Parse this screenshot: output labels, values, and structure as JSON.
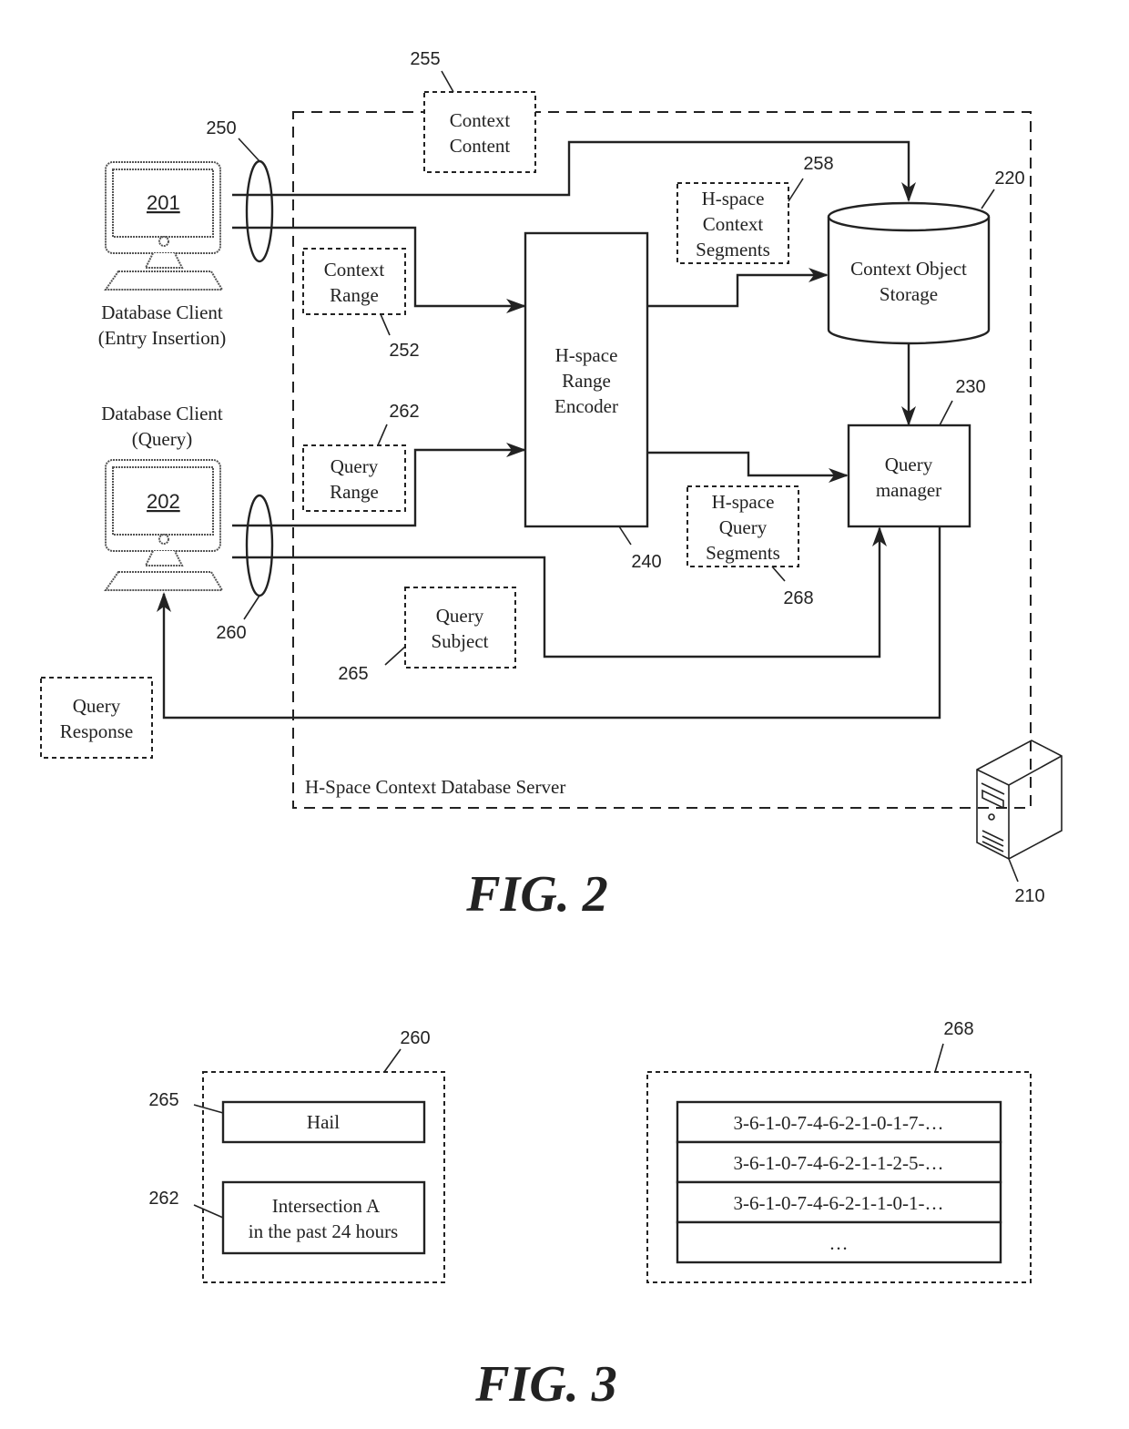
{
  "figures": {
    "fig2": {
      "caption": "FIG. 2",
      "server_boundary": {
        "label": "H-Space Context Database Server"
      },
      "clients": [
        {
          "id": "201",
          "label_line1": "Database Client",
          "label_line2": "(Entry Insertion)"
        },
        {
          "id": "202",
          "label_line1": "Database Client",
          "label_line2": "(Query)"
        }
      ],
      "data_items": {
        "context_content": {
          "ref": "255",
          "line1": "Context",
          "line2": "Content"
        },
        "context_range": {
          "ref": "252",
          "line1": "Context",
          "line2": "Range"
        },
        "query_range": {
          "ref": "262",
          "line1": "Query",
          "line2": "Range"
        },
        "query_subject": {
          "ref": "265",
          "line1": "Query",
          "line2": "Subject"
        },
        "query_response": {
          "line1": "Query",
          "line2": "Response"
        },
        "hspace_context_segments": {
          "ref": "258",
          "line1": "H-space",
          "line2": "Context",
          "line3": "Segments"
        },
        "hspace_query_segments": {
          "ref": "268",
          "line1": "H-space",
          "line2": "Query",
          "line3": "Segments"
        }
      },
      "components": {
        "encoder": {
          "ref": "240",
          "line1": "H-space",
          "line2": "Range",
          "line3": "Encoder"
        },
        "storage": {
          "ref": "220",
          "line1": "Context Object",
          "line2": "Storage"
        },
        "query_manager": {
          "ref": "230",
          "line1": "Query",
          "line2": "manager"
        },
        "server": {
          "ref": "210"
        }
      },
      "bundles": {
        "insertion": {
          "ref": "250"
        },
        "query": {
          "ref": "260"
        }
      }
    },
    "fig3": {
      "caption": "FIG. 3",
      "query": {
        "ref": "260",
        "subject": {
          "ref": "265",
          "value": "Hail"
        },
        "range": {
          "ref": "262",
          "line1": "Intersection A",
          "line2": "in the past 24 hours"
        }
      },
      "segments": {
        "ref": "268",
        "rows": [
          "3-6-1-0-7-4-6-2-1-0-1-7-…",
          "3-6-1-0-7-4-6-2-1-1-2-5-…",
          "3-6-1-0-7-4-6-2-1-1-0-1-…",
          "…"
        ]
      }
    }
  }
}
